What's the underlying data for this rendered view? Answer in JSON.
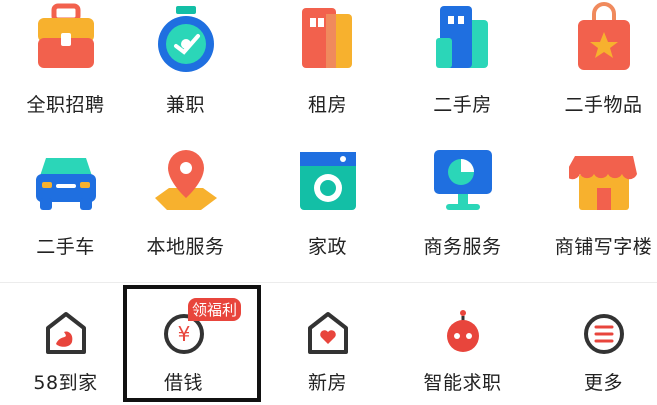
{
  "grid": {
    "row1": [
      {
        "label": "全职招聘",
        "icon": "briefcase-icon"
      },
      {
        "label": "兼职",
        "icon": "stopwatch-icon"
      },
      {
        "label": "租房",
        "icon": "building-icon"
      },
      {
        "label": "二手房",
        "icon": "tower-icon"
      },
      {
        "label": "二手物品",
        "icon": "shopping-bag-icon"
      }
    ],
    "row2": [
      {
        "label": "二手车",
        "icon": "car-icon"
      },
      {
        "label": "本地服务",
        "icon": "map-pin-icon"
      },
      {
        "label": "家政",
        "icon": "washing-machine-icon"
      },
      {
        "label": "商务服务",
        "icon": "monitor-chart-icon"
      },
      {
        "label": "商铺写字楼",
        "icon": "storefront-icon"
      }
    ]
  },
  "bottom": [
    {
      "label": "58到家",
      "icon": "swan-house-icon"
    },
    {
      "label": "借钱",
      "icon": "yen-coin-icon",
      "badge": "领福利"
    },
    {
      "label": "新房",
      "icon": "heart-house-icon"
    },
    {
      "label": "智能求职",
      "icon": "robot-icon"
    },
    {
      "label": "更多",
      "icon": "more-menu-icon"
    }
  ],
  "colors": {
    "accent": "#e8453c",
    "text": "#222222"
  }
}
